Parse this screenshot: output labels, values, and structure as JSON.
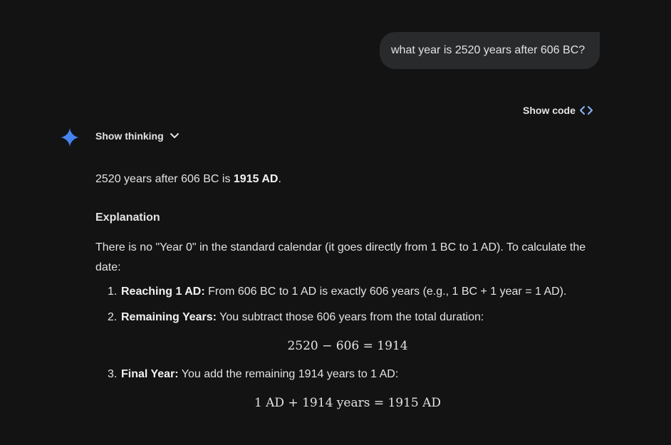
{
  "user_query": "what year is 2520 years after 606 BC?",
  "show_code": {
    "label": "Show code",
    "icon": "code-brackets-icon"
  },
  "show_thinking": {
    "label": "Show thinking",
    "icon": "chevron-down-icon"
  },
  "assistant_icon": "gemini-spark-icon",
  "colors": {
    "background": "#131314",
    "bubble": "#282a2c",
    "text": "#e3e3e3",
    "accent": "#4c8df6"
  },
  "response": {
    "answer_prefix": "2520 years after 606 BC is ",
    "answer_bold": "1915 AD",
    "answer_suffix": ".",
    "heading": "Explanation",
    "intro": "There is no \"Year 0\" in the standard calendar (it goes directly from 1 BC to 1 AD). To calculate the date:",
    "steps": [
      {
        "number": "1.",
        "bold": "Reaching 1 AD:",
        "text": " From 606 BC to 1 AD is exactly 606 years (e.g., 1 BC + 1 year = 1 AD)."
      },
      {
        "number": "2.",
        "bold": "Remaining Years:",
        "text": " You subtract those 606 years from the total duration:",
        "equation": "2520 − 606 = 1914"
      },
      {
        "number": "3.",
        "bold": "Final Year:",
        "text": " You add the remaining 1914 years to 1 AD:",
        "equation": "1 AD + 1914 years = 1915 AD"
      }
    ]
  }
}
